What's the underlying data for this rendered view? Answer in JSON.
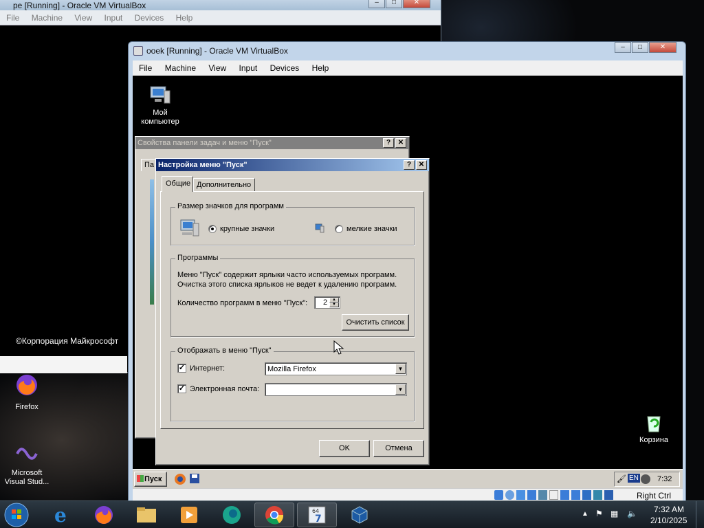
{
  "window1": {
    "title": "pe [Running] - Oracle VM VirtualBox",
    "menu": [
      "File",
      "Machine",
      "View",
      "Input",
      "Devices",
      "Help"
    ],
    "copyright": "©Корпорация Майкрософт"
  },
  "window2": {
    "title": "ooek [Running] - Oracle VM VirtualBox",
    "menu": [
      "File",
      "Machine",
      "View",
      "Input",
      "Devices",
      "Help"
    ],
    "host_key": "Right Ctrl"
  },
  "guest_desktop": {
    "my_computer_line1": "Мой",
    "my_computer_line2": "компьютер",
    "recycle_bin": "Корзина"
  },
  "bg_dialog": {
    "title": "Свойства панели задач и меню \"Пуск\"",
    "tab_partial": "Па"
  },
  "dialog": {
    "title": "Настройка меню \"Пуск\"",
    "tabs": [
      "Общие",
      "Дополнительно"
    ],
    "icon_size_group": "Размер значков для программ",
    "large_icons": "крупные значки",
    "small_icons": "мелкие значки",
    "programs_group": "Программы",
    "programs_desc1": "Меню \"Пуск\" содержит ярлыки часто используемых программ.",
    "programs_desc2": "Очистка этого списка ярлыков не ведет к удалению программ.",
    "program_count_label": "Количество программ в меню \"Пуск\":",
    "program_count_value": "2",
    "clear_list": "Очистить список",
    "show_group": "Отображать в меню \"Пуск\"",
    "internet_label": "Интернет:",
    "internet_value": "Mozilla Firefox",
    "email_label": "Электронная почта:",
    "email_value": "",
    "ok": "OK",
    "cancel": "Отмена"
  },
  "guest_taskbar": {
    "start": "Пуск",
    "lang": "EN",
    "time": "7:32"
  },
  "host_desktop_icons": [
    {
      "label": "Firefox"
    },
    {
      "label1": "Microsoft",
      "label2": "Visual Stud..."
    }
  ],
  "host_taskbar": {
    "time": "7:32 AM",
    "date": "2/10/2025"
  }
}
